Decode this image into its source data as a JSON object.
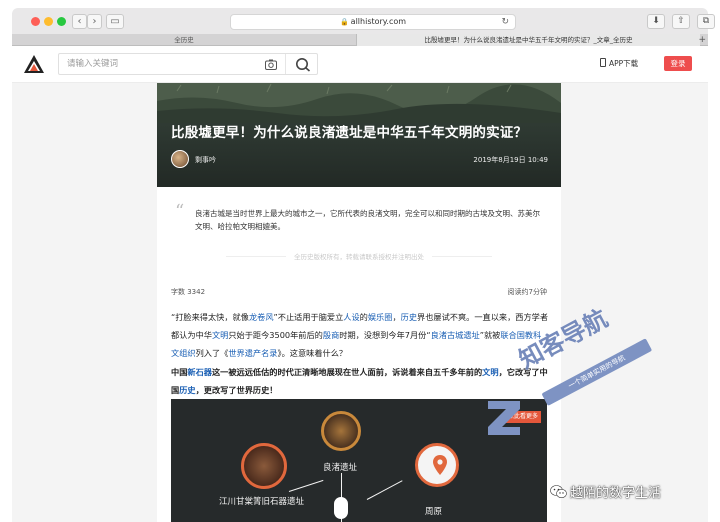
{
  "browser": {
    "url": "allhistory.com",
    "tabs": [
      {
        "label": "全历史",
        "active": false
      },
      {
        "label": "比殷墟更早！为什么说良渚遗址是中华五千年文明的实证？_文章_全历史",
        "active": true
      }
    ]
  },
  "header": {
    "search_placeholder": "请输入关键词",
    "app_download": "APP下载",
    "login": "登录"
  },
  "article": {
    "title": "比殷墟更早！为什么说良渚遗址是中华五千年文明的实证？",
    "author": "剩事吟",
    "date": "2019年8月19日 10:49",
    "summary": "良渚古城是当时世界上最大的城市之一，它所代表的良渚文明，完全可以和同时期的古埃及文明、苏美尔文明、哈拉帕文明相媲美。",
    "copyright": "全历史版权所有，转载请联系授权并注明出处",
    "word_count": "字数 3342",
    "read_time": "阅读约7分钟",
    "para1": {
      "s1": "“打脸来得太快，就像",
      "l1": "龙卷风",
      "s2": "”不止适用于脑爱立",
      "l2": "人设",
      "s3": "的",
      "l3": "娱乐圈",
      "s4": "，",
      "l4": "历史",
      "s5": "界也屡试不爽。一直以来，西方学者都认为中华",
      "l5": "文明",
      "s6": "只始于距今3500年前后的",
      "l6": "殷商",
      "s7": "时期，没想到今年7月份“",
      "l7": "良渚古城遗址",
      "s8": "”就被",
      "l8": "联合国教科文组织",
      "s9": "列入了《",
      "l9": "世界遗产名录",
      "s10": "》。这意味着什么？"
    },
    "para2": {
      "s1": "中国",
      "l1": "新石器",
      "s2": "这一被远远低估的时代正清晰地展现在世人面前，诉说着来自五千多年前的",
      "l2": "文明",
      "s3": "，它改写了中国",
      "l3": "历史",
      "s4": "，更改写了世界历史！"
    },
    "infographic": {
      "label1": "江川甘棠箐旧石器遗址",
      "label2": "良渚遗址",
      "label3": "周原",
      "tag": "点此看更多"
    }
  },
  "watermark": {
    "main": "知客导航",
    "sub": "一个简单实用的导航",
    "wechat": "越陌的数字生活"
  },
  "colors": {
    "login_bg": "#ee4d4d",
    "link": "#1a5fb4",
    "accent_orange": "#e1683d"
  }
}
